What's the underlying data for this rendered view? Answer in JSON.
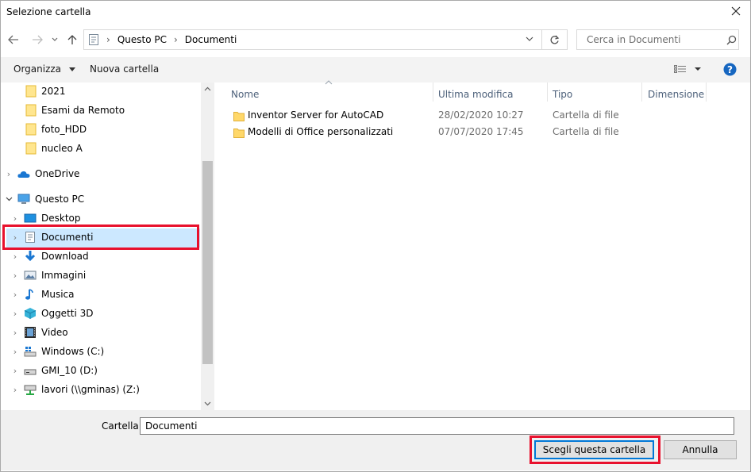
{
  "window": {
    "title": "Selezione cartella"
  },
  "address": {
    "segments": [
      "Questo PC",
      "Documenti"
    ]
  },
  "search": {
    "placeholder": "Cerca in Documenti"
  },
  "toolbar": {
    "organize_label": "Organizza",
    "new_folder_label": "Nuova cartella"
  },
  "sidebar": {
    "items": [
      {
        "label": "2021",
        "icon": "folder-icon"
      },
      {
        "label": "Esami da Remoto",
        "icon": "folder-icon"
      },
      {
        "label": "foto_HDD",
        "icon": "folder-icon"
      },
      {
        "label": "nucleo A",
        "icon": "folder-icon"
      },
      {
        "label": "OneDrive",
        "icon": "onedrive-icon"
      },
      {
        "label": "Questo PC",
        "icon": "pc-icon"
      },
      {
        "label": "Desktop",
        "icon": "desktop-icon"
      },
      {
        "label": "Documenti",
        "icon": "documents-icon",
        "selected": true
      },
      {
        "label": "Download",
        "icon": "download-icon"
      },
      {
        "label": "Immagini",
        "icon": "pictures-icon"
      },
      {
        "label": "Musica",
        "icon": "music-icon"
      },
      {
        "label": "Oggetti 3D",
        "icon": "3d-objects-icon"
      },
      {
        "label": "Video",
        "icon": "video-icon"
      },
      {
        "label": "Windows (C:)",
        "icon": "drive-c-icon"
      },
      {
        "label": "GMI_10 (D:)",
        "icon": "drive-icon"
      },
      {
        "label": "lavori (\\\\gminas) (Z:)",
        "icon": "network-drive-icon"
      }
    ]
  },
  "columns": {
    "name": "Nome",
    "modified": "Ultima modifica",
    "type": "Tipo",
    "size": "Dimensione"
  },
  "files": [
    {
      "name": "Inventor Server for AutoCAD",
      "modified": "28/02/2020 10:27",
      "type": "Cartella di file",
      "size": ""
    },
    {
      "name": "Modelli di Office personalizzati",
      "modified": "07/07/2020 17:45",
      "type": "Cartella di file",
      "size": ""
    }
  ],
  "footer": {
    "folder_label": "Cartella:",
    "folder_value": "Documenti",
    "choose_label": "Scegli questa cartella",
    "cancel_label": "Annulla"
  },
  "colors": {
    "selection": "#cce8ff",
    "highlight_outline": "#e8112d",
    "accent": "#0078d7",
    "folder": "#ffd86a"
  }
}
